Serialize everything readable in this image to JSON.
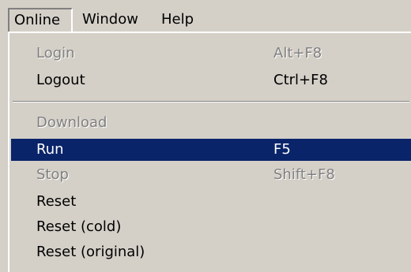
{
  "menubar": {
    "items": [
      {
        "label": "Online",
        "open": true
      },
      {
        "label": "Window"
      },
      {
        "label": "Help"
      }
    ]
  },
  "online_menu": {
    "items": [
      {
        "label": "Login",
        "shortcut": "Alt+F8",
        "enabled": false
      },
      {
        "label": "Logout",
        "shortcut": "Ctrl+F8",
        "enabled": true
      },
      {
        "separator": true
      },
      {
        "label": "Download",
        "shortcut": "",
        "enabled": false
      },
      {
        "label": "Run",
        "shortcut": "F5",
        "enabled": true,
        "selected": true
      },
      {
        "label": "Stop",
        "shortcut": "Shift+F8",
        "enabled": false
      },
      {
        "label": "Reset",
        "shortcut": "",
        "enabled": true
      },
      {
        "label": "Reset (cold)",
        "shortcut": "",
        "enabled": true
      },
      {
        "label": "Reset (original)",
        "shortcut": "",
        "enabled": true
      }
    ]
  },
  "colors": {
    "face": "#d4d0c8",
    "highlight": "#0a246a",
    "disabled_text": "#808080"
  }
}
